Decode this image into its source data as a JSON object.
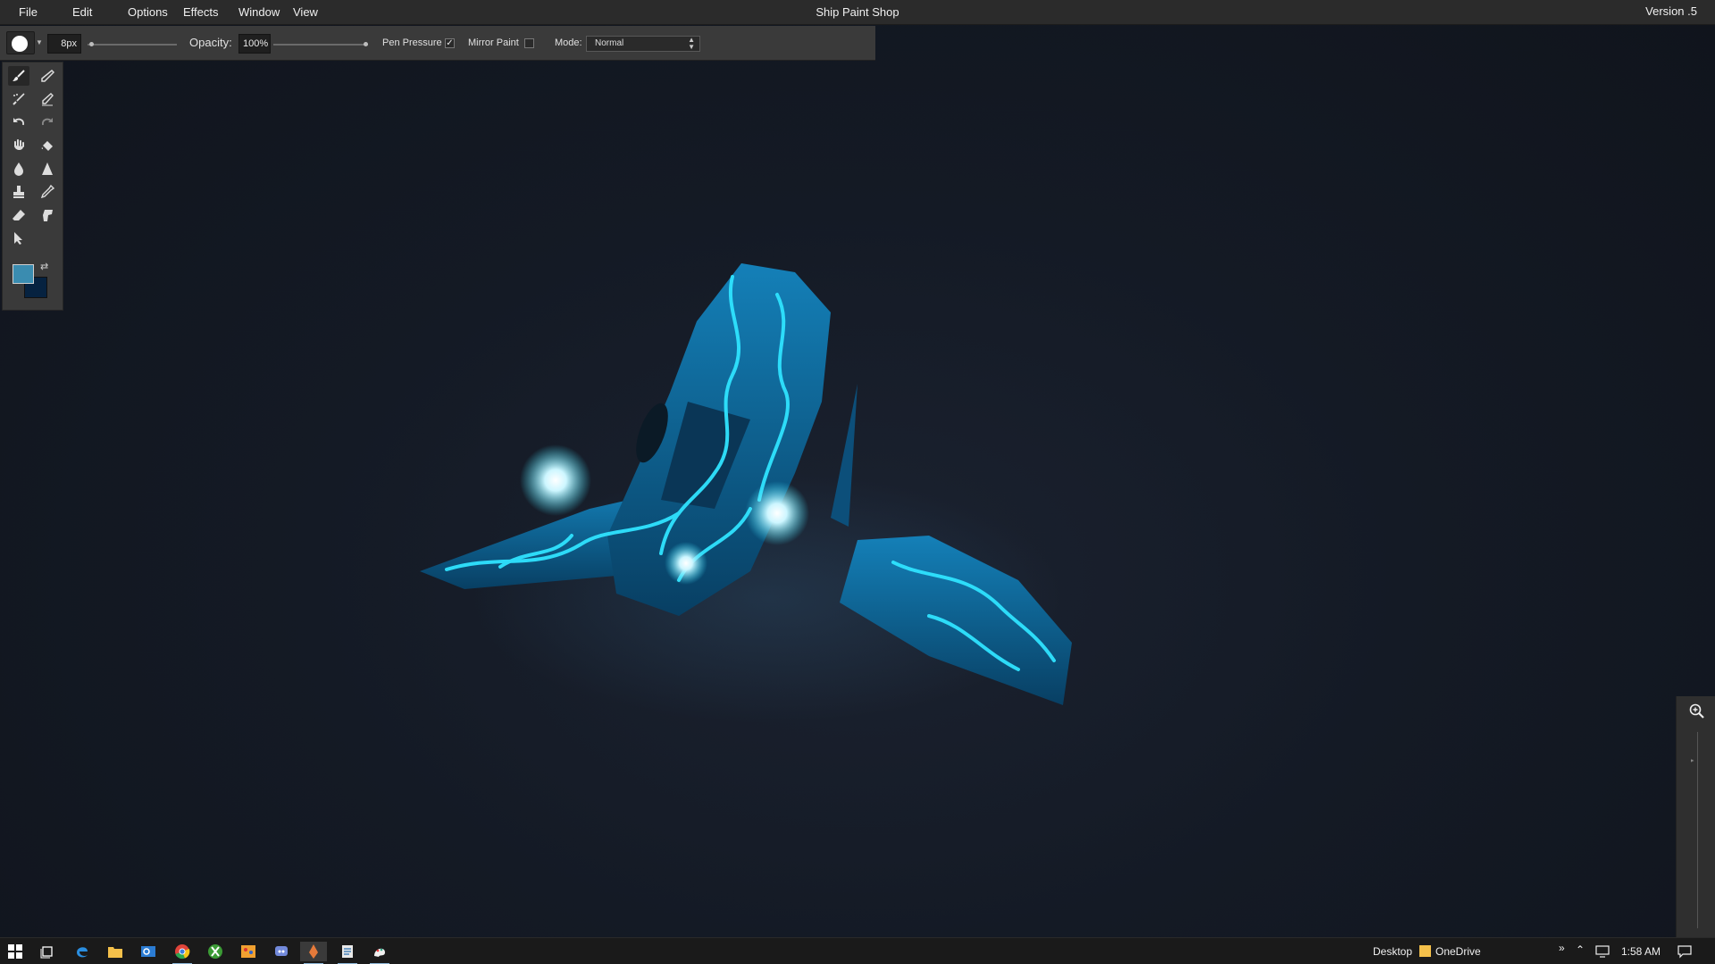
{
  "menubar": {
    "items": [
      "File",
      "Edit",
      "Options",
      "Effects",
      "Window",
      "View"
    ],
    "app_title": "Ship Paint Shop",
    "version": "Version .5"
  },
  "options_bar": {
    "brush_size": "8px",
    "opacity_label": "Opacity:",
    "opacity_value": "100%",
    "pen_pressure_label": "Pen Pressure",
    "pen_pressure_checked": true,
    "mirror_paint_label": "Mirror Paint",
    "mirror_paint_checked": false,
    "mode_label": "Mode:",
    "mode_value": "Normal"
  },
  "tools": {
    "items": [
      "paintbrush-icon",
      "pencil-icon",
      "airbrush-icon",
      "smudge-icon",
      "undo-icon",
      "redo-icon",
      "hand-icon",
      "fill-bucket-icon",
      "blur-drop-icon",
      "sharpen-icon",
      "stamp-icon",
      "eyedropper-icon",
      "eraser-icon",
      "finger-icon",
      "select-arrow-icon"
    ],
    "active": "paintbrush-icon",
    "foreground_color": "#3a8cb0",
    "background_color": "#062240"
  },
  "zoom_panel": {
    "icon": "zoom-in-icon"
  },
  "taskbar": {
    "apps": [
      "start-icon",
      "task-view-icon",
      "edge-icon",
      "file-explorer-icon",
      "outlook-icon",
      "chrome-icon",
      "xbox-icon",
      "paint-app-icon",
      "discord-icon",
      "ship-paint-shop-icon",
      "notepad-icon",
      "paint-3d-icon"
    ],
    "tray_desktop": "Desktop",
    "tray_onedrive": "OneDrive",
    "clock": "1:58 AM"
  },
  "colors": {
    "menu_bg": "#2b2b2b",
    "panel_bg": "#3a3a3a",
    "ship_glow": "#2fe3ff",
    "ship_hull": "#0d5a86"
  }
}
